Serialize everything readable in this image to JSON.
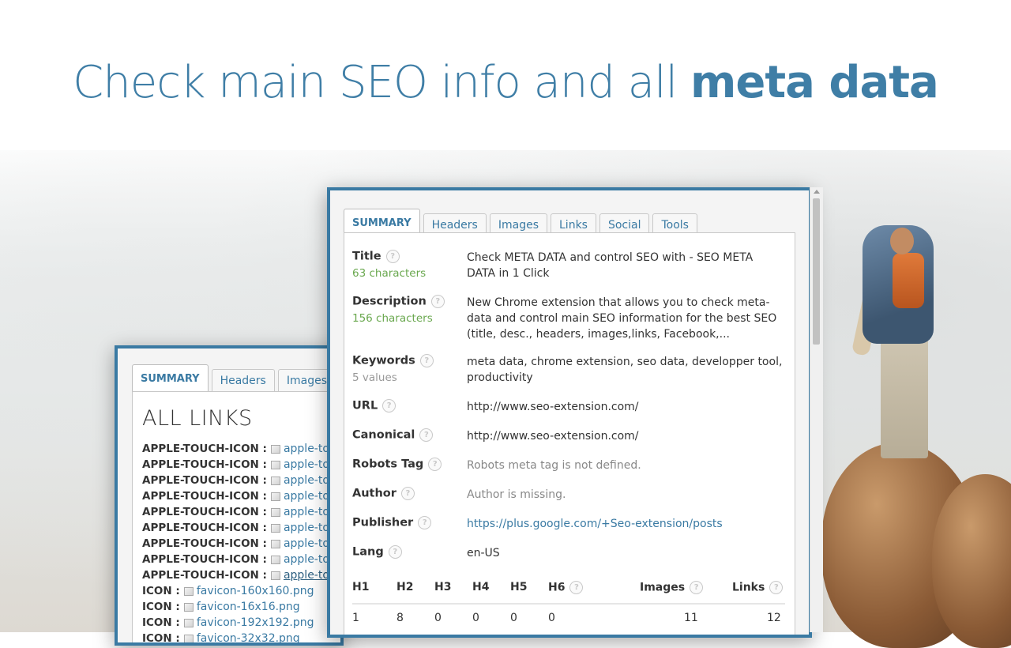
{
  "hero": {
    "title_light": "Check main SEO info and all ",
    "title_bold": "meta data"
  },
  "back_panel": {
    "tabs": [
      "SUMMARY",
      "Headers",
      "Images"
    ],
    "heading": "ALL LINKS",
    "links": [
      {
        "label": "APPLE-TOUCH-ICON :",
        "value": "apple-touch"
      },
      {
        "label": "APPLE-TOUCH-ICON :",
        "value": "apple-touch"
      },
      {
        "label": "APPLE-TOUCH-ICON :",
        "value": "apple-touch"
      },
      {
        "label": "APPLE-TOUCH-ICON :",
        "value": "apple-touch"
      },
      {
        "label": "APPLE-TOUCH-ICON :",
        "value": "apple-touch"
      },
      {
        "label": "APPLE-TOUCH-ICON :",
        "value": "apple-touch"
      },
      {
        "label": "APPLE-TOUCH-ICON :",
        "value": "apple-touch"
      },
      {
        "label": "APPLE-TOUCH-ICON :",
        "value": "apple-touch"
      },
      {
        "label": "APPLE-TOUCH-ICON :",
        "value": "apple-touch"
      },
      {
        "label": "ICON :",
        "value": "favicon-160x160.png"
      },
      {
        "label": "ICON :",
        "value": "favicon-16x16.png"
      },
      {
        "label": "ICON :",
        "value": "favicon-192x192.png"
      },
      {
        "label": "ICON :",
        "value": "favicon-32x32.png"
      }
    ]
  },
  "front_panel": {
    "tabs": [
      "SUMMARY",
      "Headers",
      "Images",
      "Links",
      "Social",
      "Tools"
    ],
    "help_glyph": "?",
    "rows": {
      "title": {
        "key": "Title",
        "sub": "63 characters",
        "value": "Check META DATA and control SEO with - SEO META DATA in 1 Click"
      },
      "description": {
        "key": "Description",
        "sub": "156 characters",
        "value": "New Chrome extension that allows you to check meta-data and control main SEO information for the best SEO (title, desc., headers, images,links, Facebook,..."
      },
      "keywords": {
        "key": "Keywords",
        "sub": "5 values",
        "value": "meta data, chrome extension, seo data, developper tool, productivity"
      },
      "url": {
        "key": "URL",
        "value": "http://www.seo-extension.com/"
      },
      "canonical": {
        "key": "Canonical",
        "value": "http://www.seo-extension.com/"
      },
      "robots": {
        "key": "Robots Tag",
        "value": "Robots meta tag is not defined."
      },
      "author": {
        "key": "Author",
        "value": "Author is missing."
      },
      "publisher": {
        "key": "Publisher",
        "value": "https://plus.google.com/+Seo-extension/posts"
      },
      "lang": {
        "key": "Lang",
        "value": "en-US"
      }
    },
    "stats": {
      "headers": [
        "H1",
        "H2",
        "H3",
        "H4",
        "H5",
        "H6",
        "Images",
        "Links"
      ],
      "values": [
        "1",
        "8",
        "0",
        "0",
        "0",
        "0",
        "11",
        "12"
      ]
    }
  },
  "colors": {
    "accent": "#3a7aa3",
    "green": "#6aa84f",
    "muted": "#888888"
  }
}
